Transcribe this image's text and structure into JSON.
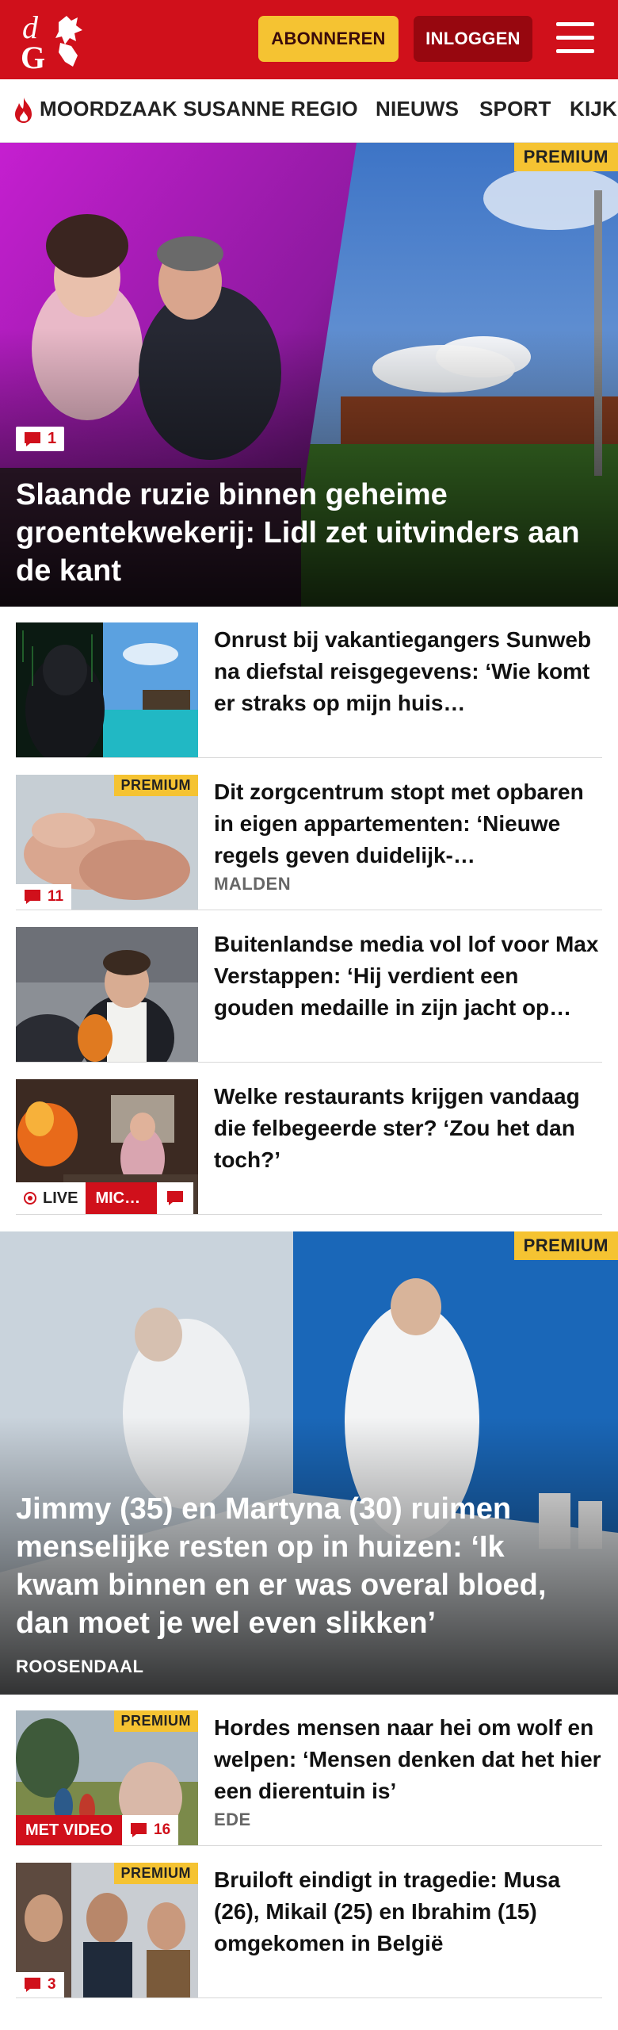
{
  "header": {
    "logo_text": "dG",
    "subscribe_label": "ABONNEREN",
    "login_label": "INLOGGEN",
    "brand_color": "#d0101b",
    "accent_color": "#f5c332"
  },
  "nav": {
    "items": [
      "MOORDZAAK SUSANNE",
      "REGIO",
      "NIEUWS",
      "SPORT",
      "KIJK"
    ],
    "trending_icon": "flame-icon"
  },
  "hero1": {
    "premium": "PREMIUM",
    "comments": "1",
    "title": "Slaande ruzie binnen geheime groentekwekerij: Lidl zet uitvinders aan de kant"
  },
  "articles1": [
    {
      "title": "Onrust bij vakantiegangers Sunweb na diefstal reisgegevens: ‘Wie komt er straks op mijn huis…"
    },
    {
      "premium": "PREMIUM",
      "comments": "11",
      "title": "Dit zorgcentrum stopt met opbaren in eigen appartementen: ‘Nieuwe regels geven duidelijk-…",
      "location": "MALDEN"
    },
    {
      "title": "Buitenlandse media vol lof voor Max Verstappen: ‘Hij verdient een gouden medaille in zijn jacht op…"
    },
    {
      "live": "LIVE",
      "live_tag": "MIC…",
      "title": "Welke restaurants krijgen vandaag die felbegeerde ster? ‘Zou het dan toch?’"
    }
  ],
  "hero2": {
    "premium": "PREMIUM",
    "title": "Jimmy (35) en Martyna (30) ruimen menselijke resten op in huizen: ‘Ik kwam binnen en er was overal bloed, dan moet je wel even slikken’",
    "location": "ROOSENDAAL"
  },
  "articles2": [
    {
      "premium": "PREMIUM",
      "video": "MET VIDEO",
      "comments": "16",
      "title": "Hordes mensen naar hei om wolf en welpen: ‘Mensen denken dat het hier een dierentuin is’",
      "location": "EDE"
    },
    {
      "premium": "PREMIUM",
      "comments": "3",
      "title": "Bruiloft eindigt in tragedie: Musa (26), Mikail (25) en Ibrahim (15) omgekomen in België"
    }
  ]
}
